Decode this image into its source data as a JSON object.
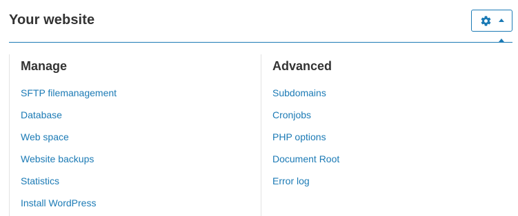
{
  "header": {
    "title": "Your website",
    "settings_icon": "gear-icon",
    "dropdown_icon": "caret-up-icon"
  },
  "colors": {
    "accent": "#1b7ab5",
    "text": "#333333",
    "divider": "#e2e2e2"
  },
  "manage": {
    "title": "Manage",
    "links": [
      {
        "label": "SFTP filemanagement"
      },
      {
        "label": "Database"
      },
      {
        "label": "Web space"
      },
      {
        "label": "Website backups"
      },
      {
        "label": "Statistics"
      },
      {
        "label": "Install WordPress"
      }
    ]
  },
  "advanced": {
    "title": "Advanced",
    "links": [
      {
        "label": "Subdomains"
      },
      {
        "label": "Cronjobs"
      },
      {
        "label": "PHP options"
      },
      {
        "label": "Document Root"
      },
      {
        "label": "Error log"
      }
    ]
  }
}
